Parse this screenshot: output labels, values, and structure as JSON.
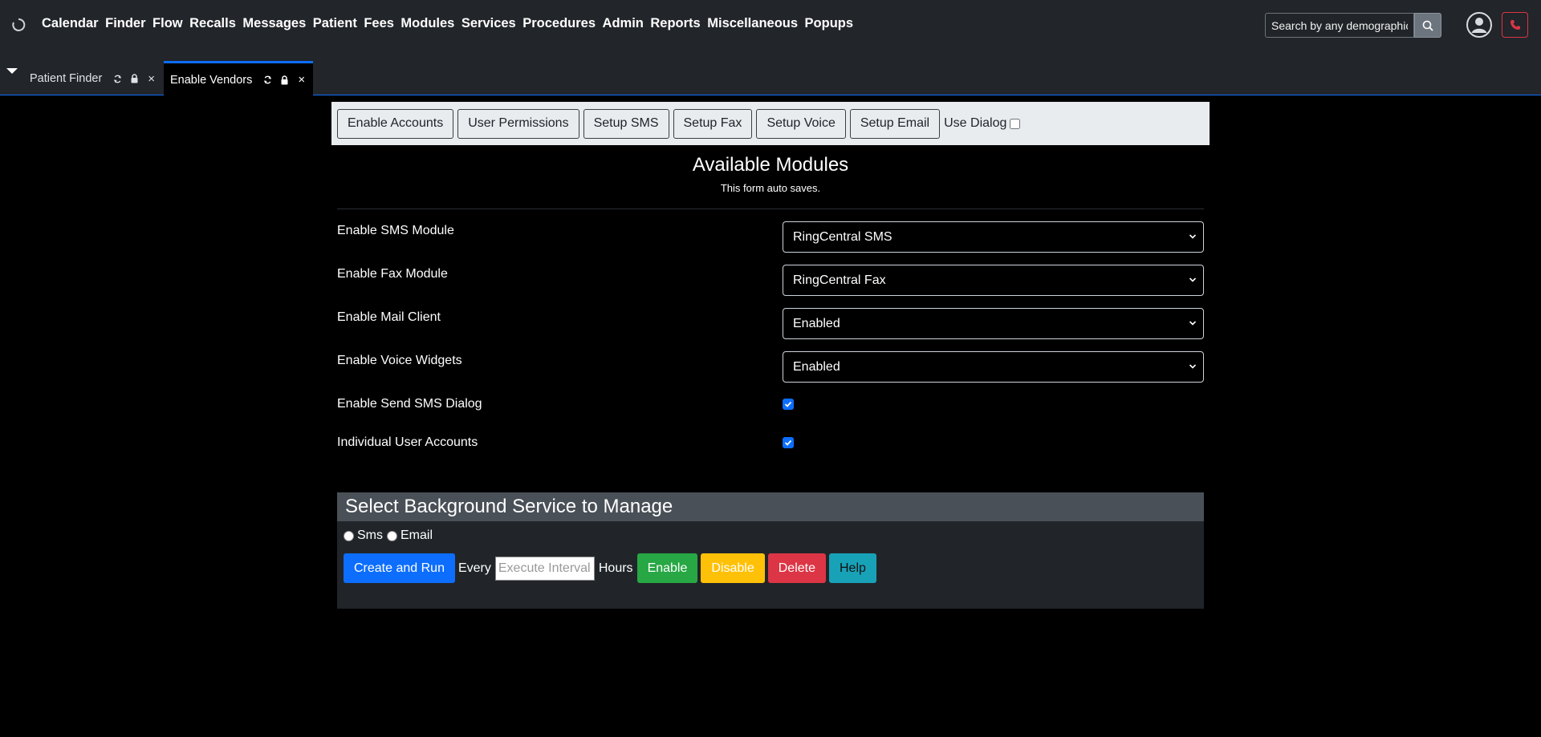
{
  "nav": {
    "items": [
      "Calendar",
      "Finder",
      "Flow",
      "Recalls",
      "Messages",
      "Patient",
      "Fees",
      "Modules",
      "Services",
      "Procedures",
      "Admin",
      "Reports",
      "Miscellaneous",
      "Popups"
    ],
    "search_placeholder": "Search by any demographics"
  },
  "tabs": [
    {
      "label": "Patient Finder",
      "active": false
    },
    {
      "label": "Enable Vendors",
      "active": true
    }
  ],
  "toolbar": {
    "buttons": [
      "Enable Accounts",
      "User Permissions",
      "Setup SMS",
      "Setup Fax",
      "Setup Voice",
      "Setup Email"
    ],
    "use_dialog_label": "Use Dialog",
    "use_dialog_checked": false
  },
  "page": {
    "title": "Available Modules",
    "subtitle": "This form auto saves."
  },
  "settings": [
    {
      "label": "Enable SMS Module",
      "type": "select",
      "value": "RingCentral SMS"
    },
    {
      "label": "Enable Fax Module",
      "type": "select",
      "value": "RingCentral Fax"
    },
    {
      "label": "Enable Mail Client",
      "type": "select",
      "value": "Enabled"
    },
    {
      "label": "Enable Voice Widgets",
      "type": "select",
      "value": "Enabled"
    },
    {
      "label": "Enable Send SMS Dialog",
      "type": "checkbox",
      "checked": true
    },
    {
      "label": "Individual User Accounts",
      "type": "checkbox",
      "checked": true
    }
  ],
  "service": {
    "title": "Select Background Service to Manage",
    "radio_sms": "Sms",
    "radio_email": "Email",
    "create_run": "Create and Run",
    "every": "Every",
    "interval_placeholder": "Execute Interval",
    "hours": "Hours",
    "enable": "Enable",
    "disable": "Disable",
    "delete": "Delete",
    "help": "Help"
  },
  "colors": {
    "primary": "#0d6efd",
    "success": "#28a745",
    "warning": "#ffc107",
    "danger": "#dc3545",
    "info": "#17a2b8"
  }
}
